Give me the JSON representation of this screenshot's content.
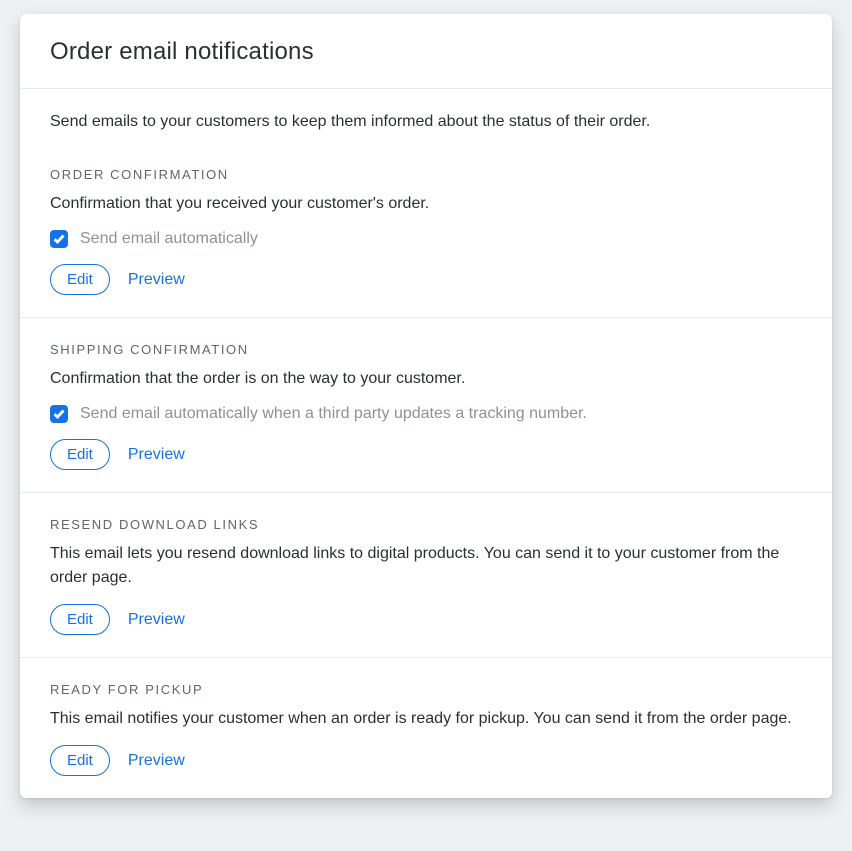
{
  "page": {
    "title": "Order email notifications",
    "intro": "Send emails to your customers to keep them informed about the status of their order."
  },
  "sections": {
    "orderConfirmation": {
      "heading": "ORDER CONFIRMATION",
      "desc": "Confirmation that you received your customer's order.",
      "checkboxLabel": "Send email automatically",
      "edit": "Edit",
      "preview": "Preview"
    },
    "shippingConfirmation": {
      "heading": "SHIPPING CONFIRMATION",
      "desc": "Confirmation that the order is on the way to your customer.",
      "checkboxLabel": "Send email automatically when a third party updates a tracking number.",
      "edit": "Edit",
      "preview": "Preview"
    },
    "resendDownloadLinks": {
      "heading": "RESEND DOWNLOAD LINKS",
      "desc": "This email lets you resend download links to digital products. You can send it to your customer from the order page.",
      "edit": "Edit",
      "preview": "Preview"
    },
    "readyForPickup": {
      "heading": "READY FOR PICKUP",
      "desc": "This email notifies your customer when an order is ready for pickup. You can send it from the order page.",
      "edit": "Edit",
      "preview": "Preview"
    }
  }
}
